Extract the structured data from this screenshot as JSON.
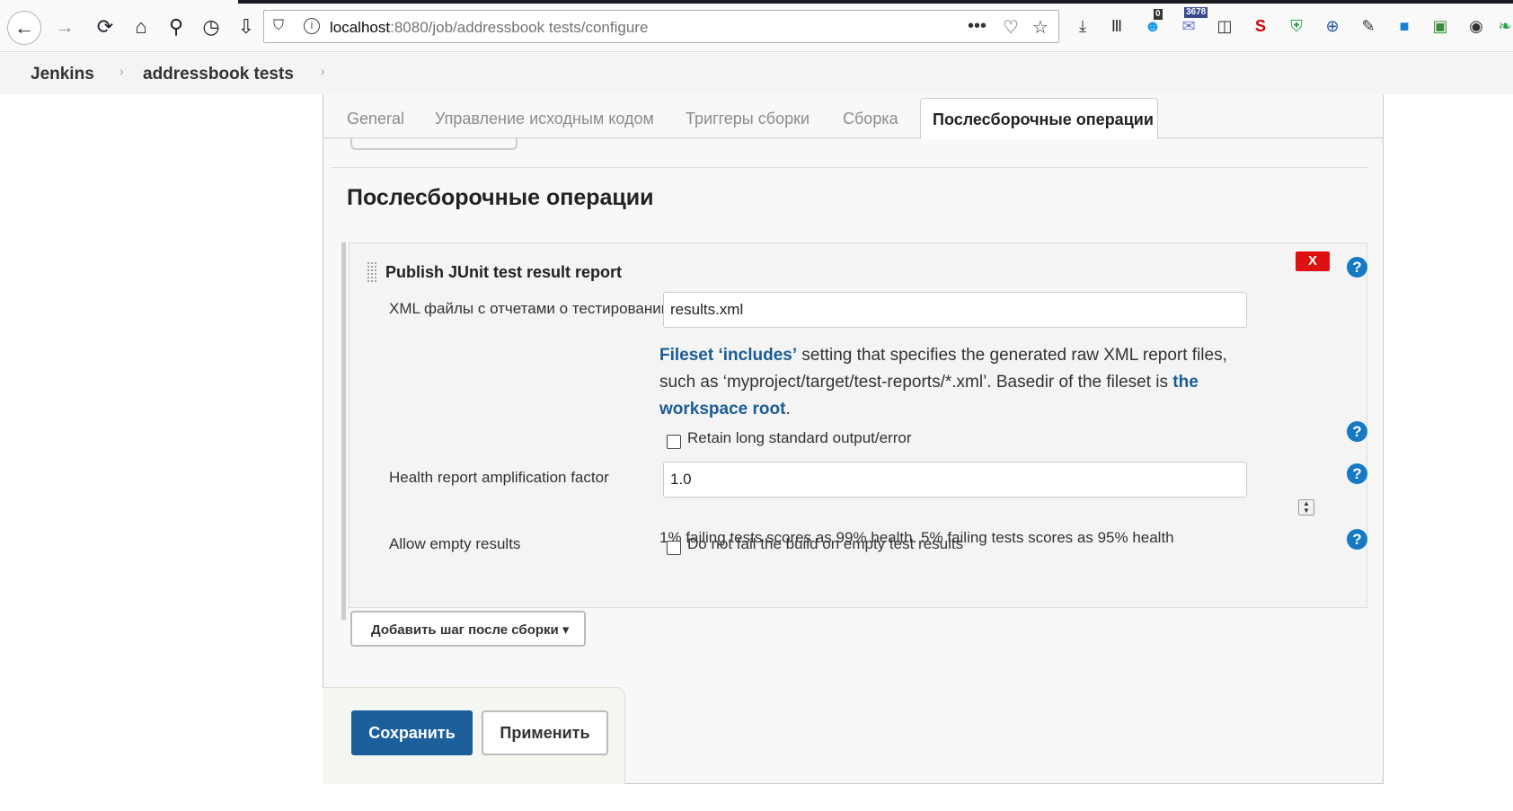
{
  "browser": {
    "url_host": "localhost",
    "url_rest": ":8080/job/addressbook tests/configure",
    "badge_notifications": "0",
    "badge_count": "3678"
  },
  "breadcrumb": {
    "items": [
      "Jenkins",
      "addressbook tests"
    ]
  },
  "tabs": {
    "items": [
      "General",
      "Управление исходным кодом",
      "Триггеры сборки",
      "Сборка"
    ],
    "active": "Послесборочные операции"
  },
  "section": {
    "title": "Послесборочные операции"
  },
  "publisher": {
    "title": "Publish JUnit test result report",
    "delete_label": "X",
    "help_label": "?",
    "xml_label": "XML файлы с отчетами о тестировании",
    "xml_value": "results.xml",
    "description": {
      "link1": "Fileset ‘includes’",
      "text1": " setting that specifies the generated raw XML report files, such as ‘myproject/target/test-reports/*.xml’. Basedir of the fileset is ",
      "link2": "the workspace root",
      "text2": "."
    },
    "retain_label": "Retain long standard output/error",
    "retain_checked": false,
    "health_label": "Health report amplification factor",
    "health_value": "1.0",
    "health_hint": "1% failing tests scores as 99% health. 5% failing tests scores as 95% health",
    "allow_empty_label": "Allow empty results",
    "allow_empty_cb_label": "Do not fail the build on empty test results",
    "allow_empty_checked": false
  },
  "add_step": {
    "label": "Добавить шаг после сборки ▾"
  },
  "actions": {
    "save_label": "Сохранить",
    "apply_label": "Применить"
  },
  "colors": {
    "save_button": "#1c5f9b",
    "link": "#1a5c96",
    "delete": "#dd1111",
    "help": "#1579c4"
  }
}
